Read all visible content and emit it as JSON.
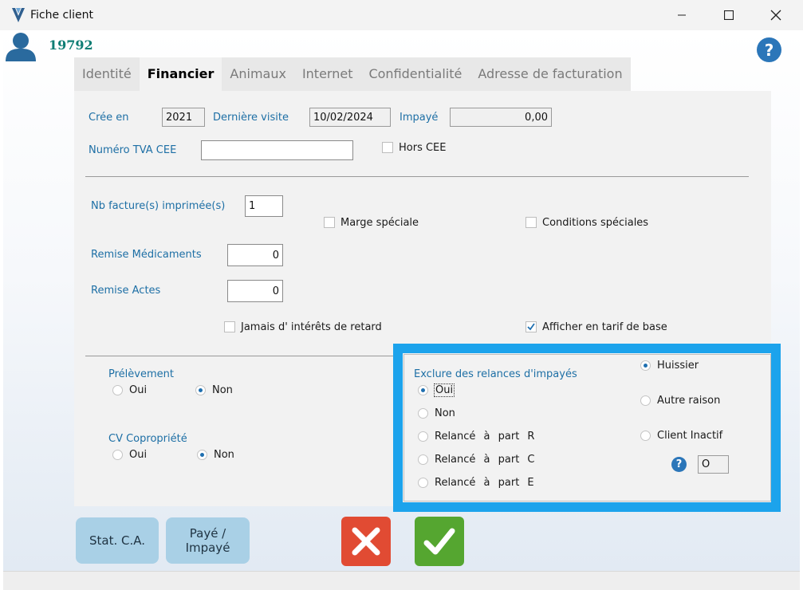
{
  "window": {
    "title": "Fiche client"
  },
  "client": {
    "id": "19792"
  },
  "tabs": [
    {
      "label": "Identité"
    },
    {
      "label": "Financier"
    },
    {
      "label": "Animaux"
    },
    {
      "label": "Internet"
    },
    {
      "label": "Confidentialité"
    },
    {
      "label": "Adresse de facturation"
    }
  ],
  "form": {
    "cree_en_label": "Crée en",
    "cree_en_value": "2021",
    "derniere_visite_label": "Dernière visite",
    "derniere_visite_value": "10/02/2024",
    "impaye_label": "Impayé",
    "impaye_value": "0,00",
    "tva_label": "Numéro TVA CEE",
    "tva_value": "",
    "hors_cee_label": "Hors CEE",
    "nb_factures_label": "Nb facture(s) imprimée(s)",
    "nb_factures_value": "1",
    "marge_speciale_label": "Marge spéciale",
    "conditions_speciales_label": "Conditions spéciales",
    "remise_medicaments_label": "Remise Médicaments",
    "remise_medicaments_value": "0",
    "remise_actes_label": "Remise Actes",
    "remise_actes_value": "0",
    "jamais_interets_label": "Jamais d' intérêts de retard",
    "afficher_tarif_label": "Afficher en tarif de base"
  },
  "prelevement": {
    "label": "Prélèvement",
    "oui": "Oui",
    "non": "Non",
    "selected": "Non"
  },
  "cv_copropriete": {
    "label": "CV Copropriété",
    "oui": "Oui",
    "non": "Non",
    "selected": "Non"
  },
  "exclure": {
    "label": "Exclure des relances d'impayés",
    "options": [
      "Oui",
      "Non",
      "Relancé à part R",
      "Relancé à part C",
      "Relancé à part E"
    ],
    "selected": "Oui",
    "reasons": [
      "Huissier",
      "Autre raison",
      "Client Inactif"
    ],
    "reason_selected": "Huissier",
    "code_value": "O"
  },
  "buttons": {
    "stat_ca": "Stat. C.A.",
    "paye_line1": "Payé /",
    "paye_line2": "Impayé"
  },
  "icons": {
    "app": "logo-icon",
    "user": "user-icon",
    "help": "help-icon",
    "cancel": "cancel-x-icon",
    "ok": "checkmark-icon"
  },
  "colors": {
    "label_blue": "#1d6fa5",
    "id_green": "#0e7d74",
    "highlight": "#1ca3ec",
    "cancel_red": "#e14b33",
    "ok_green": "#55a630"
  }
}
